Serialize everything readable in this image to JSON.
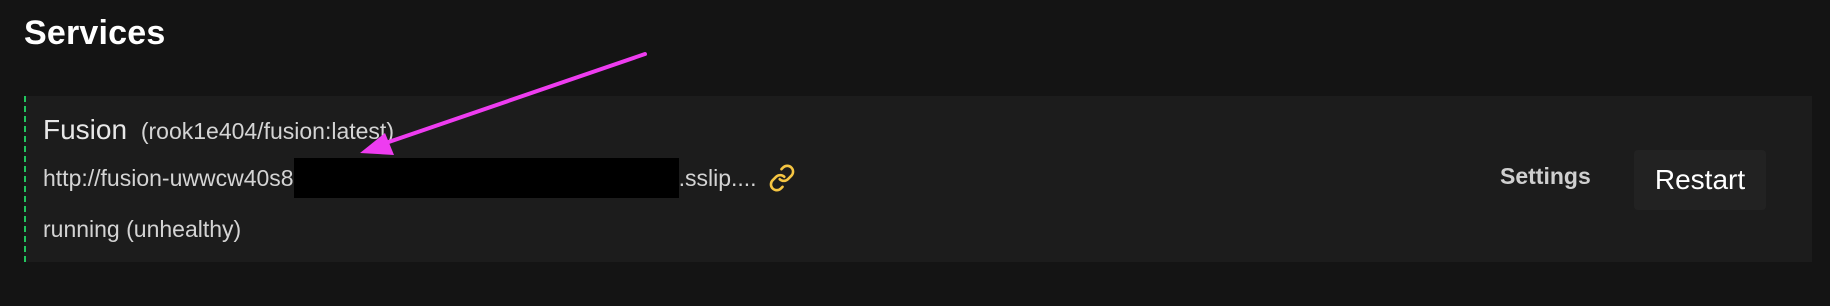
{
  "page": {
    "title": "Services"
  },
  "service": {
    "name": "Fusion",
    "image": "(rook1e404/fusion:latest)",
    "url_prefix": "http://fusion-uwwcw40s8",
    "url_suffix": ".sslip....",
    "status": "running (unhealthy)",
    "settings_label": "Settings",
    "restart_label": "Restart",
    "link_icon": "link-icon"
  },
  "colors": {
    "background": "#141414",
    "card": "#1c1c1c",
    "healthy_border": "#22c55e",
    "link_icon": "#f5c542",
    "annotation_arrow": "#ee3cf0"
  }
}
